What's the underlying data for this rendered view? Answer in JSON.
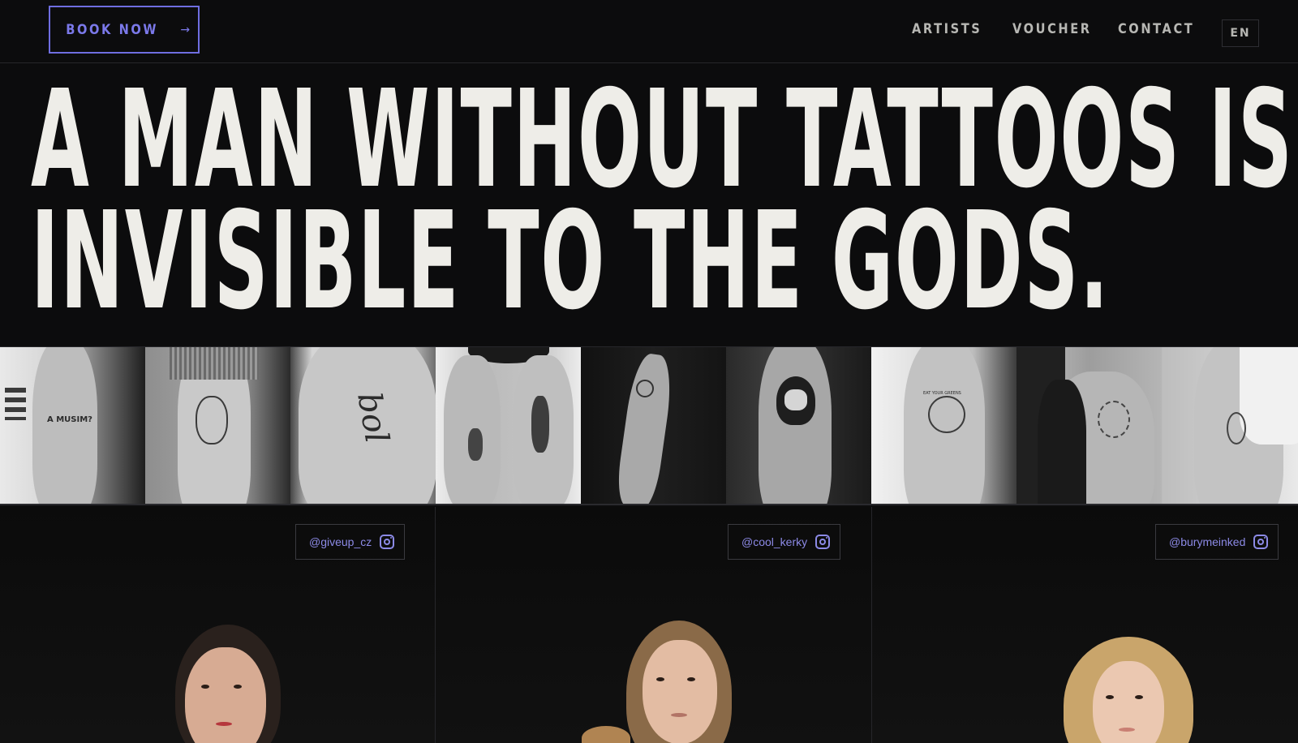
{
  "header": {
    "book_label": "BOOK NOW",
    "book_arrow": "→",
    "nav": [
      {
        "label": "ARTISTS"
      },
      {
        "label": "VOUCHER"
      },
      {
        "label": "CONTACT"
      }
    ],
    "lang": "EN"
  },
  "hero": {
    "line1": "A MAN WITHOUT TATTOOS IS",
    "line2": "INVISIBLE TO THE GODS."
  },
  "strip": {
    "tiles": [
      {
        "ink_text": "A MUSIM?"
      },
      {
        "ink_text": ""
      },
      {
        "ink_text": "bol"
      },
      {
        "ink_text": ""
      },
      {
        "ink_text": ""
      },
      {
        "ink_text": ""
      },
      {
        "ink_text": "EAT YOUR GREENS"
      },
      {
        "ink_text": ""
      },
      {
        "ink_text": ""
      }
    ]
  },
  "artists": [
    {
      "handle": "@giveup_cz",
      "icon": "instagram-icon"
    },
    {
      "handle": "@cool_kerky",
      "icon": "instagram-icon"
    },
    {
      "handle": "@burymeinked",
      "icon": "instagram-icon"
    }
  ],
  "colors": {
    "background": "#0c0c0d",
    "accent": "#7b79ea",
    "headline": "#eeede8",
    "nav_text": "#b7b7b3"
  }
}
